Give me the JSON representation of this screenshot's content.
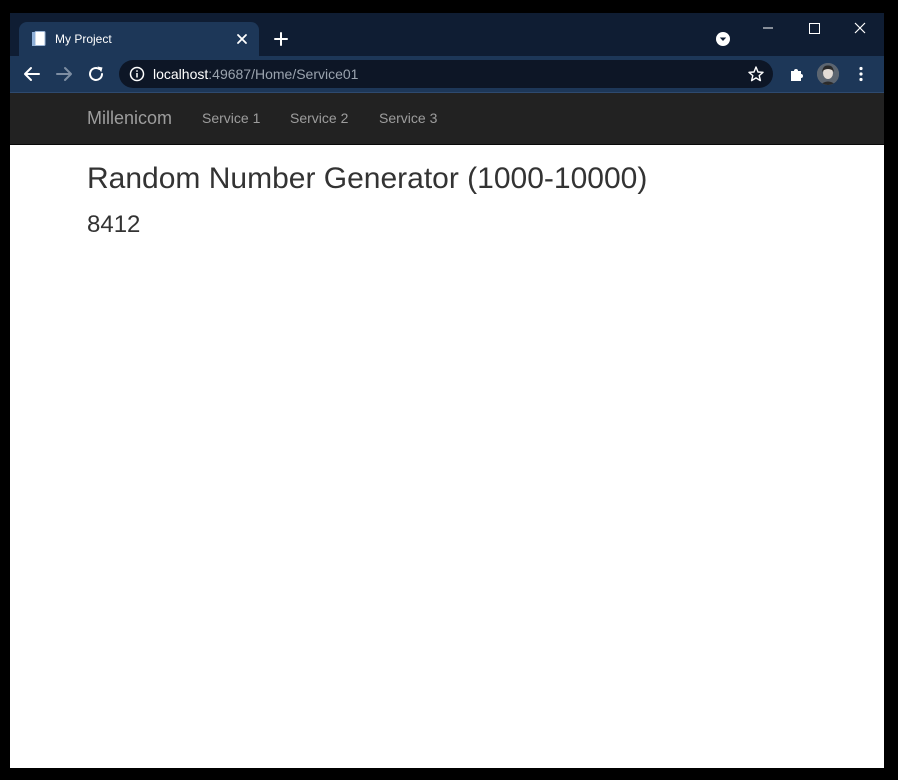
{
  "browser": {
    "tab": {
      "title": "My Project"
    },
    "address_bar": {
      "host": "localhost",
      "path": ":49687/Home/Service01"
    }
  },
  "site": {
    "brand": "Millenicom",
    "nav": [
      {
        "label": "Service 1"
      },
      {
        "label": "Service 2"
      },
      {
        "label": "Service 3"
      }
    ]
  },
  "main": {
    "title": "Random Number Generator (1000-10000)",
    "result": "8412"
  },
  "colors": {
    "tabstrip_bg": "#0f1d33",
    "toolbar_bg": "#1d3758",
    "navbar_bg": "#222222",
    "nav_text": "#9d9d9d",
    "body_text": "#333333"
  },
  "icons": {
    "favicon": "page-icon",
    "tab_close": "close-icon",
    "new_tab": "plus-icon",
    "tab_search": "tab-search-icon",
    "back": "arrow-left-icon",
    "forward": "arrow-right-icon",
    "reload": "reload-icon",
    "site_info": "info-icon",
    "bookmark": "star-icon",
    "extensions": "puzzle-icon",
    "profile": "avatar",
    "menu": "kebab-menu-icon",
    "minimize": "minimize-icon",
    "maximize": "maximize-icon",
    "close_window": "close-window-icon"
  }
}
